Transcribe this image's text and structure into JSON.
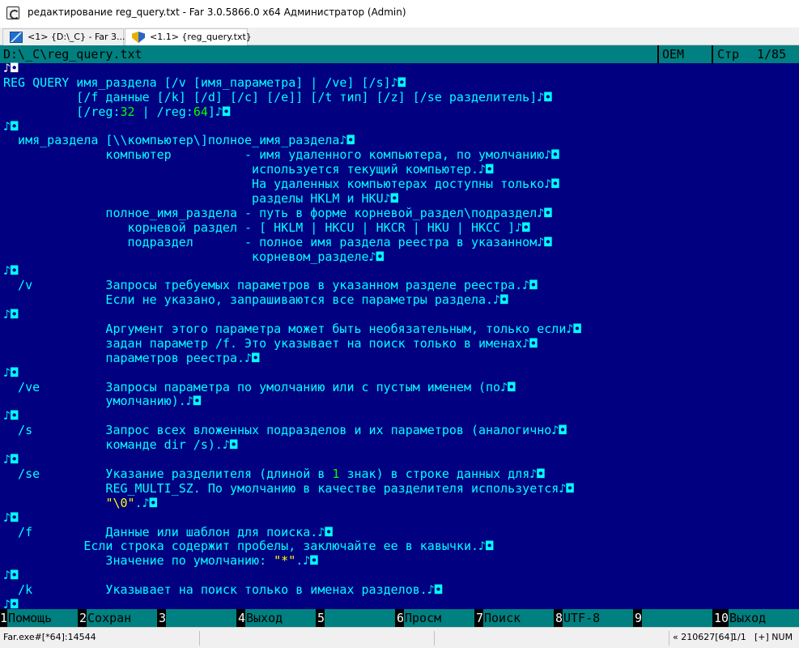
{
  "window": {
    "title": "редактирование reg_query.txt - Far 3.0.5866.0 x64 Администратор (Admin)"
  },
  "tabs": [
    {
      "label": "<1> {D:\\_C} - Far 3...",
      "icon": "far-panels-icon"
    },
    {
      "label": "<1.1> {reg_query.txt}",
      "icon": "uac-shield-icon"
    }
  ],
  "status": {
    "path": "D:\\_C\\reg_query.txt",
    "encoding": "OEM",
    "mode": "Стр",
    "position": "1/85"
  },
  "lines": [
    [
      {
        "t": "♪◘"
      }
    ],
    [
      {
        "t": "REG QUERY имя_раздела [/v [имя_параметра] | /ve] [/s]♪◘"
      }
    ],
    [
      {
        "t": "          [/f данные [/k] [/d] [/c] [/e]] [/t тип] [/z] [/se разделитель]♪◘"
      }
    ],
    [
      {
        "t": "          [/reg:"
      },
      {
        "t": "32",
        "c": "num"
      },
      {
        "t": " | /reg:"
      },
      {
        "t": "64",
        "c": "num"
      },
      {
        "t": "]♪◘"
      }
    ],
    [
      {
        "t": "♪◘"
      }
    ],
    [
      {
        "t": "  имя_раздела [\\\\компьютер\\]полное_имя_раздела♪◘"
      }
    ],
    [
      {
        "t": "              компьютер          - имя удаленного компьютера, по умолчанию♪◘"
      }
    ],
    [
      {
        "t": "                                  используется текущий компьютер.♪◘"
      }
    ],
    [
      {
        "t": "                                  На удаленных компьютерах доступны только♪◘"
      }
    ],
    [
      {
        "t": "                                  разделы HKLM и HKU♪◘"
      }
    ],
    [
      {
        "t": "              полное_имя_раздела - путь в форме корневой_раздел\\подраздел♪◘"
      }
    ],
    [
      {
        "t": "                 корневой раздел - [ HKLM | HKCU | HKCR | HKU | HKCC ]♪◘"
      }
    ],
    [
      {
        "t": "                 подраздел       - полное имя раздела реестра в указанном♪◘"
      }
    ],
    [
      {
        "t": "                                  корневом_разделе♪◘"
      }
    ],
    [
      {
        "t": "♪◘"
      }
    ],
    [
      {
        "t": "  /v          Запросы требуемых параметров в указанном разделе реестра.♪◘"
      }
    ],
    [
      {
        "t": "              Если не указано, запрашиваются все параметры раздела.♪◘"
      }
    ],
    [
      {
        "t": "♪◘"
      }
    ],
    [
      {
        "t": "              Аргумент этого параметра может быть необязательным, только если♪◘"
      }
    ],
    [
      {
        "t": "              задан параметр /f. Это указывает на поиск только в именах♪◘"
      }
    ],
    [
      {
        "t": "              параметров реестра.♪◘"
      }
    ],
    [
      {
        "t": "♪◘"
      }
    ],
    [
      {
        "t": "  /ve         Запросы параметра по умолчанию или с пустым именем (по♪◘"
      }
    ],
    [
      {
        "t": "              умолчанию).♪◘"
      }
    ],
    [
      {
        "t": "♪◘"
      }
    ],
    [
      {
        "t": "  /s          Запрос всех вложенных подразделов и их параметров (аналогично♪◘"
      }
    ],
    [
      {
        "t": "              команде dir /s).♪◘"
      }
    ],
    [
      {
        "t": "♪◘"
      }
    ],
    [
      {
        "t": "  /se         Указание разделителя (длиной в "
      },
      {
        "t": "1",
        "c": "num"
      },
      {
        "t": " знак) в строке данных для♪◘"
      }
    ],
    [
      {
        "t": "              REG_MULTI_SZ. По умолчанию в качестве разделителя используется♪◘"
      }
    ],
    [
      {
        "t": "              "
      },
      {
        "t": "\"\\0\"",
        "c": "str"
      },
      {
        "t": ".♪◘"
      }
    ],
    [
      {
        "t": "♪◘"
      }
    ],
    [
      {
        "t": "  /f          Данные или шаблон для поиска.♪◘"
      }
    ],
    [
      {
        "t": "           Если строка содержит пробелы, заключайте ее в кавычки.♪◘"
      }
    ],
    [
      {
        "t": "              Значение по умолчанию: "
      },
      {
        "t": "\"*\"",
        "c": "str"
      },
      {
        "t": ".♪◘"
      }
    ],
    [
      {
        "t": "♪◘"
      }
    ],
    [
      {
        "t": "  /k          Указывает на поиск только в именах разделов.♪◘"
      }
    ],
    [
      {
        "t": "♪◘"
      }
    ]
  ],
  "keybar": [
    {
      "num": "1",
      "label": "Помощь"
    },
    {
      "num": "2",
      "label": "Сохран"
    },
    {
      "num": "3",
      "label": ""
    },
    {
      "num": "4",
      "label": "Выход"
    },
    {
      "num": "5",
      "label": ""
    },
    {
      "num": "6",
      "label": "Просм"
    },
    {
      "num": "7",
      "label": "Поиск"
    },
    {
      "num": "8",
      "label": "UTF-8"
    },
    {
      "num": "9",
      "label": ""
    },
    {
      "num": "10",
      "label": "Выход"
    }
  ],
  "bottom": {
    "process": "Far.exe#[*64]:14544",
    "cursor": "« 210627[64]",
    "page": "1/1",
    "state": "[+]  NUM"
  },
  "colors": {
    "background": "#000080",
    "text": "#00ffff",
    "number": "#00ff00",
    "string": "#ffff00",
    "bar": "#008080"
  }
}
